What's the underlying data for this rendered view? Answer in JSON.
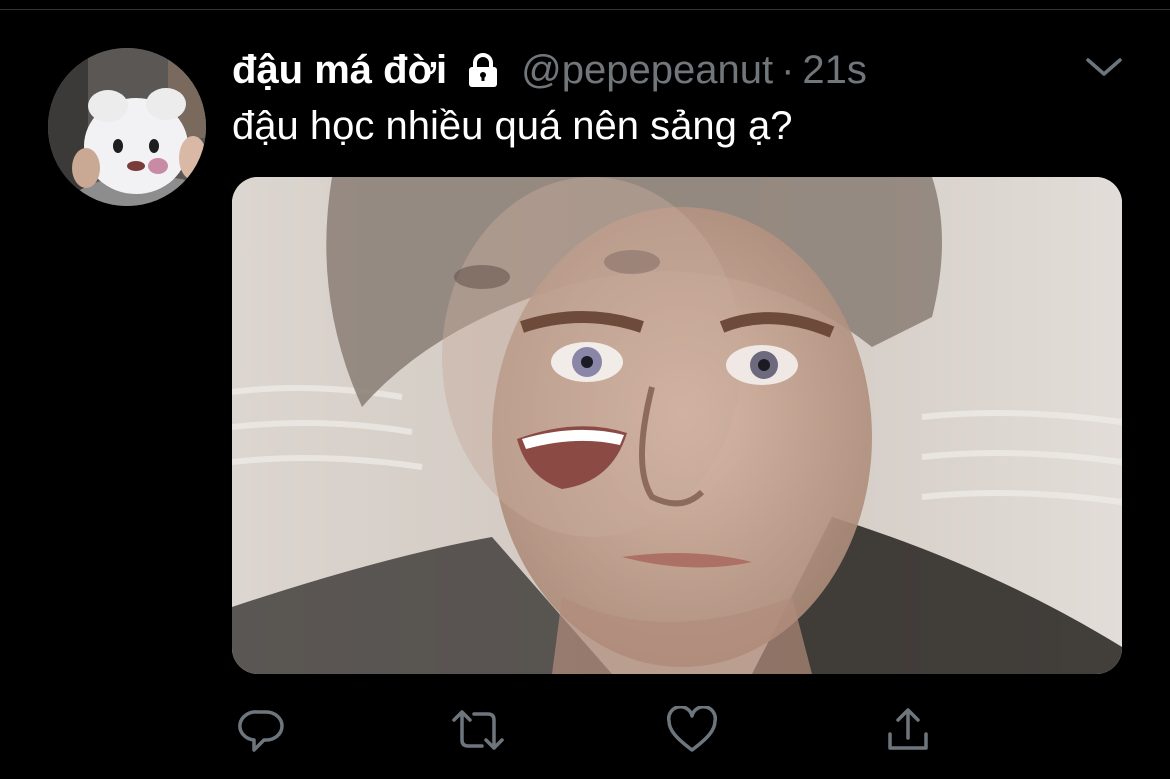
{
  "tweet": {
    "author": {
      "display_name": "đậu má đời",
      "handle": "@pepepeanut",
      "protected_icon": "lock-icon",
      "avatar": "avatar"
    },
    "separator": "·",
    "timestamp": "21s",
    "text": "đậu học nhiều quá nên sảng ạ?",
    "menu_icon": "chevron-down-icon",
    "media": "tweet-photo"
  },
  "actions": [
    {
      "name": "reply",
      "icon": "reply-icon"
    },
    {
      "name": "retweet",
      "icon": "retweet-icon"
    },
    {
      "name": "like",
      "icon": "heart-icon"
    },
    {
      "name": "share",
      "icon": "share-icon"
    }
  ],
  "colors": {
    "background": "#000000",
    "text_primary": "#ffffff",
    "text_secondary": "#71767b",
    "icon": "#6e767d",
    "divider": "#2f3336"
  }
}
